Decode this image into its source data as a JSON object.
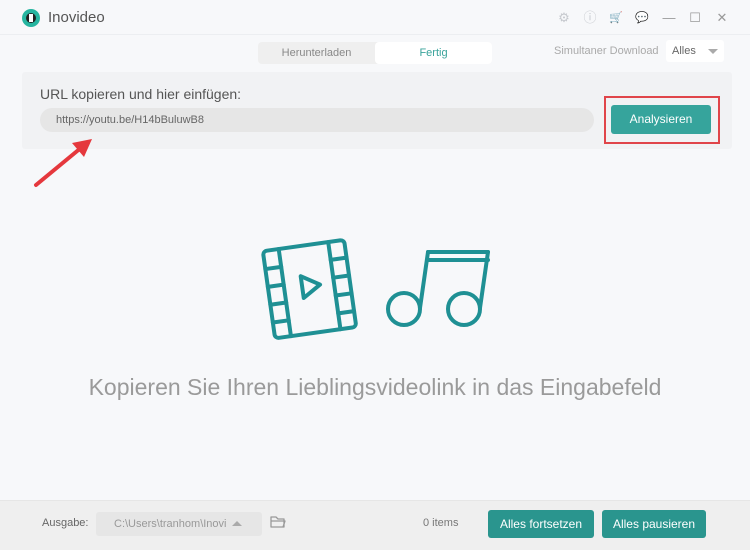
{
  "app": {
    "title": "Inovideo",
    "logo_icon": "download-logo-icon"
  },
  "titlebar": {
    "icons": [
      "gear-icon",
      "info-icon",
      "cart-icon",
      "chat-icon",
      "minimize-icon",
      "maximize-icon",
      "close-icon"
    ],
    "glyphs": [
      "⚙",
      "ⓘ",
      "🛒",
      "💬",
      "—",
      "☐",
      "✕"
    ]
  },
  "tabs": [
    {
      "label": "Herunterladen",
      "active": false
    },
    {
      "label": "Fertig",
      "active": true
    }
  ],
  "simultaneous": {
    "label": "Simultaner Download",
    "value": "Alles"
  },
  "url_panel": {
    "label": "URL kopieren und hier einfügen:",
    "value": "https://youtu.be/H14bBuluwB8",
    "analyze_label": "Analysieren"
  },
  "colors": {
    "accent": "#36a49c",
    "highlight": "#e0454a",
    "icon": "#1f9094"
  },
  "hint": "Kopieren Sie Ihren Lieblingsvideolink in das Eingabefeld",
  "footer": {
    "output_label": "Ausgabe:",
    "output_path": "C:\\Users\\tranhom\\Inovi",
    "items": "0 items",
    "resume_all": "Alles fortsetzen",
    "pause_all": "Alles pausieren"
  }
}
